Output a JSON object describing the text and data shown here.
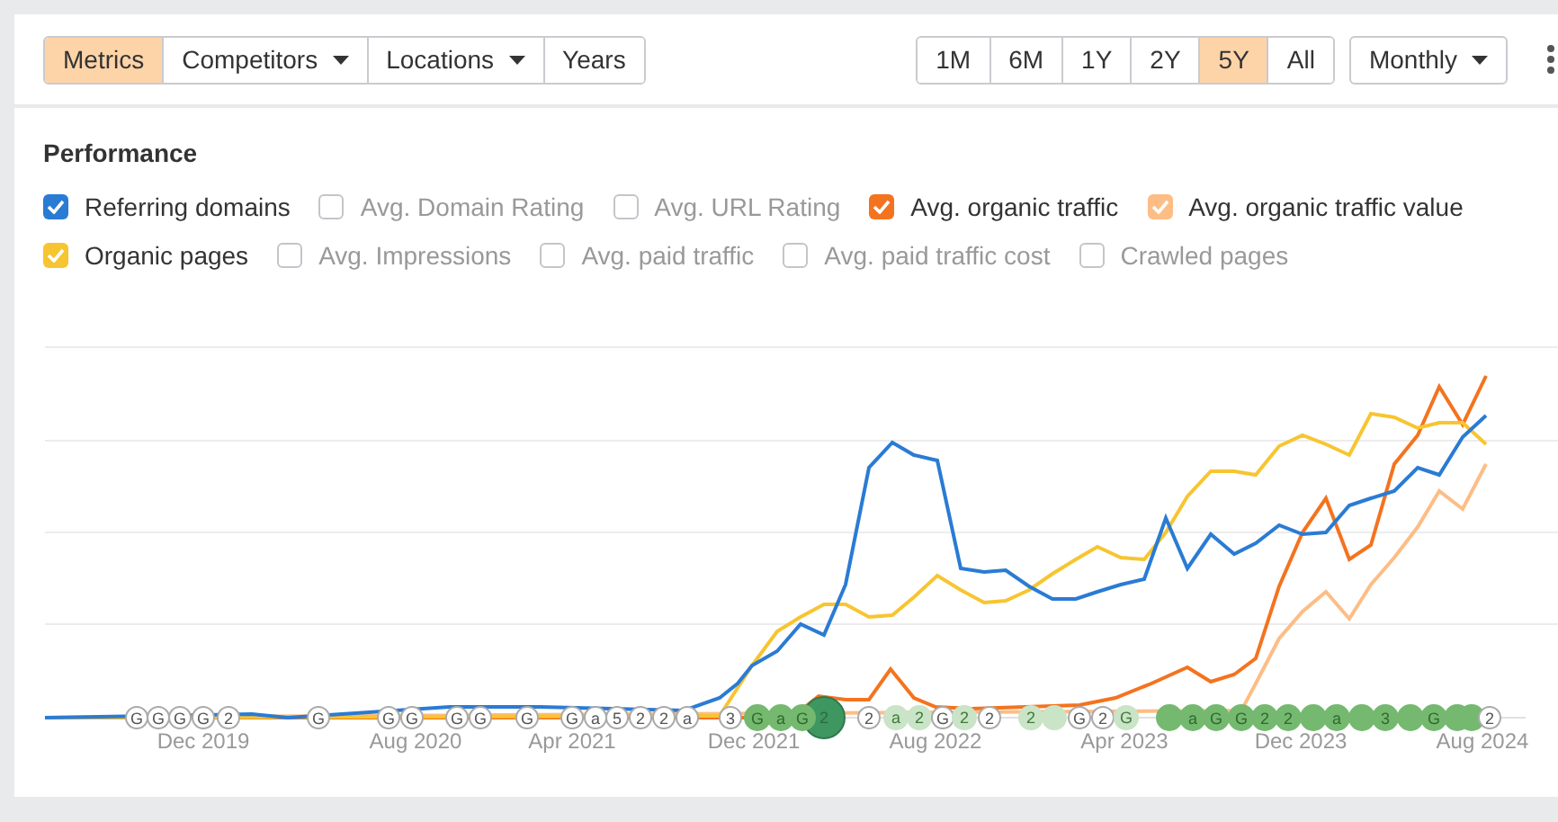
{
  "toolbar": {
    "left_buttons": [
      {
        "label": "Metrics",
        "selected": true,
        "dropdown": false
      },
      {
        "label": "Competitors",
        "selected": false,
        "dropdown": true
      },
      {
        "label": "Locations",
        "selected": false,
        "dropdown": true
      },
      {
        "label": "Years",
        "selected": false,
        "dropdown": false
      }
    ],
    "ranges": [
      {
        "label": "1M",
        "selected": false
      },
      {
        "label": "6M",
        "selected": false
      },
      {
        "label": "1Y",
        "selected": false
      },
      {
        "label": "2Y",
        "selected": false
      },
      {
        "label": "5Y",
        "selected": true
      },
      {
        "label": "All",
        "selected": false
      }
    ],
    "interval": "Monthly"
  },
  "performance": {
    "title": "Performance",
    "metric_rows": [
      [
        {
          "label": "Referring domains",
          "checked": true,
          "color": "#2a7bd4"
        },
        {
          "label": "Avg. Domain Rating",
          "checked": false
        },
        {
          "label": "Avg. URL Rating",
          "checked": false
        },
        {
          "label": "Avg. organic traffic",
          "checked": true,
          "color": "#f4731f"
        },
        {
          "label": "Avg. organic traffic value",
          "checked": true,
          "color": "#fdbd85"
        }
      ],
      [
        {
          "label": "Organic pages",
          "checked": true,
          "color": "#f7c531"
        },
        {
          "label": "Avg. Impressions",
          "checked": false
        },
        {
          "label": "Avg. paid traffic",
          "checked": false
        },
        {
          "label": "Avg. paid traffic cost",
          "checked": false
        },
        {
          "label": "Crawled pages",
          "checked": false
        }
      ]
    ],
    "x_labels": [
      "Dec 2019",
      "Aug 2020",
      "Apr 2021",
      "Dec 2021",
      "Aug 2022",
      "Apr 2023",
      "Dec 2023",
      "Aug 2024"
    ],
    "markers": [
      {
        "label": "G",
        "kind": "outline"
      },
      {
        "label": "G",
        "kind": "outline"
      },
      {
        "label": "G",
        "kind": "outline"
      },
      {
        "label": "G",
        "kind": "outline"
      },
      {
        "label": "2",
        "kind": "outline"
      },
      {
        "label": "G",
        "kind": "outline"
      },
      {
        "label": "G",
        "kind": "outline"
      },
      {
        "label": "G",
        "kind": "outline"
      },
      {
        "label": "G",
        "kind": "outline"
      },
      {
        "label": "G",
        "kind": "outline"
      },
      {
        "label": "G",
        "kind": "outline"
      },
      {
        "label": "G",
        "kind": "outline"
      },
      {
        "label": "a",
        "kind": "outline"
      },
      {
        "label": "5",
        "kind": "outline"
      },
      {
        "label": "2",
        "kind": "outline"
      },
      {
        "label": "2",
        "kind": "outline"
      },
      {
        "label": "a",
        "kind": "outline"
      },
      {
        "label": "3",
        "kind": "outline"
      },
      {
        "label": "G",
        "kind": "green"
      },
      {
        "label": "a",
        "kind": "green"
      },
      {
        "label": "G",
        "kind": "green"
      },
      {
        "label": "2",
        "kind": "big"
      },
      {
        "label": "2",
        "kind": "outline"
      },
      {
        "label": "a",
        "kind": "faint"
      },
      {
        "label": "2",
        "kind": "faint"
      },
      {
        "label": "G",
        "kind": "outline"
      },
      {
        "label": "2",
        "kind": "faint"
      },
      {
        "label": "2",
        "kind": "outline"
      },
      {
        "label": "2",
        "kind": "faint"
      },
      {
        "kind": "faint"
      },
      {
        "label": "G",
        "kind": "outline"
      },
      {
        "label": "2",
        "kind": "outline"
      },
      {
        "label": "G",
        "kind": "faint"
      },
      {
        "kind": "green"
      },
      {
        "label": "a",
        "kind": "green"
      },
      {
        "label": "G",
        "kind": "green"
      },
      {
        "label": "G",
        "kind": "green"
      },
      {
        "label": "2",
        "kind": "green"
      },
      {
        "label": "2",
        "kind": "green"
      },
      {
        "kind": "green"
      },
      {
        "label": "a",
        "kind": "green"
      },
      {
        "kind": "green"
      },
      {
        "label": "3",
        "kind": "green"
      },
      {
        "kind": "green"
      },
      {
        "label": "G",
        "kind": "green"
      },
      {
        "kind": "green"
      },
      {
        "kind": "green"
      },
      {
        "label": "2",
        "kind": "outline"
      }
    ]
  }
}
